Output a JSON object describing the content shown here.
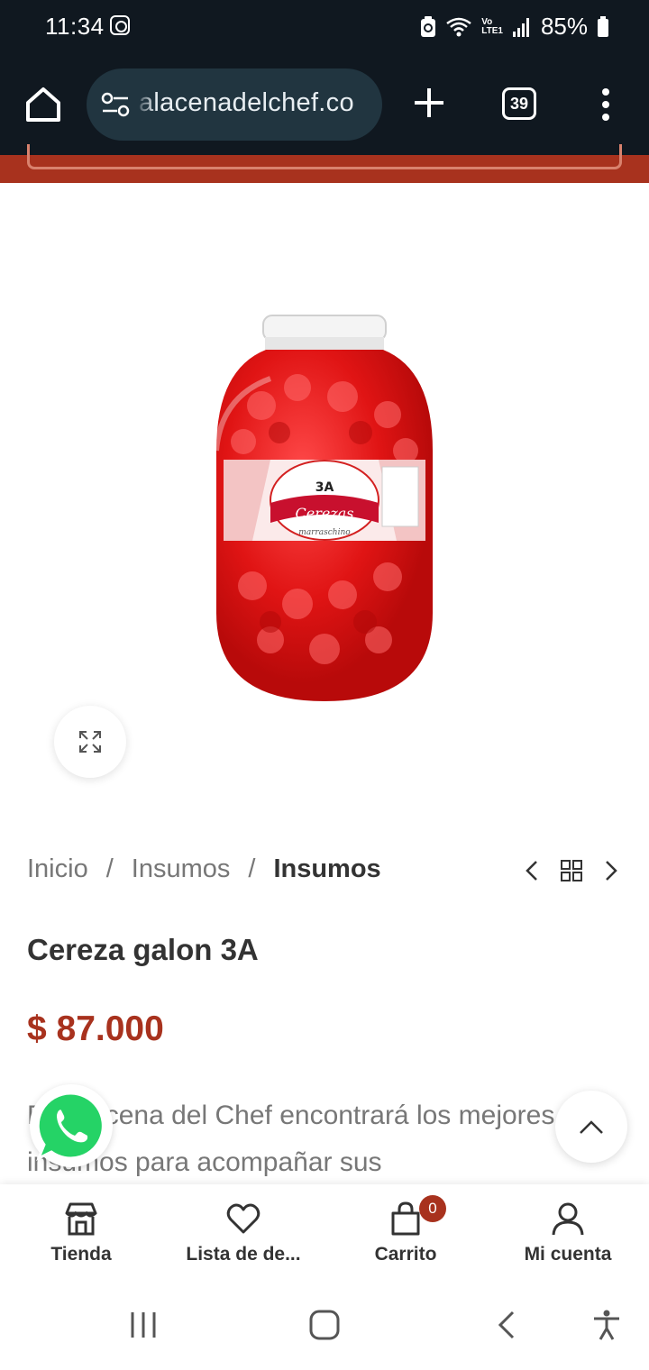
{
  "status_bar": {
    "time": "11:34",
    "network": "LTE1",
    "carrier_tag": "Vo",
    "battery": "85%"
  },
  "browser": {
    "url": "alacenadelchef.co",
    "tab_count": "39"
  },
  "product": {
    "image_label": "Cerezas",
    "image_sublabel": "marraschino",
    "image_brand": "3A",
    "title": "Cereza galon 3A",
    "price": "$ 87.000",
    "description": "En Alacena del Chef encontrará los mejores insumos para acompañar sus"
  },
  "breadcrumb": {
    "items": [
      "Inicio",
      "Insumos"
    ],
    "current": "Insumos",
    "separator": "/"
  },
  "bottom_nav": {
    "items": [
      {
        "label": "Tienda",
        "icon": "store-icon"
      },
      {
        "label": "Lista de de...",
        "icon": "heart-icon"
      },
      {
        "label": "Carrito",
        "icon": "cart-icon"
      },
      {
        "label": "Mi cuenta",
        "icon": "user-icon"
      }
    ],
    "cart_count": "0"
  },
  "colors": {
    "brand": "#a8321e",
    "browser_bar": "#101820",
    "url_pill": "#213540",
    "whatsapp": "#25d366"
  }
}
